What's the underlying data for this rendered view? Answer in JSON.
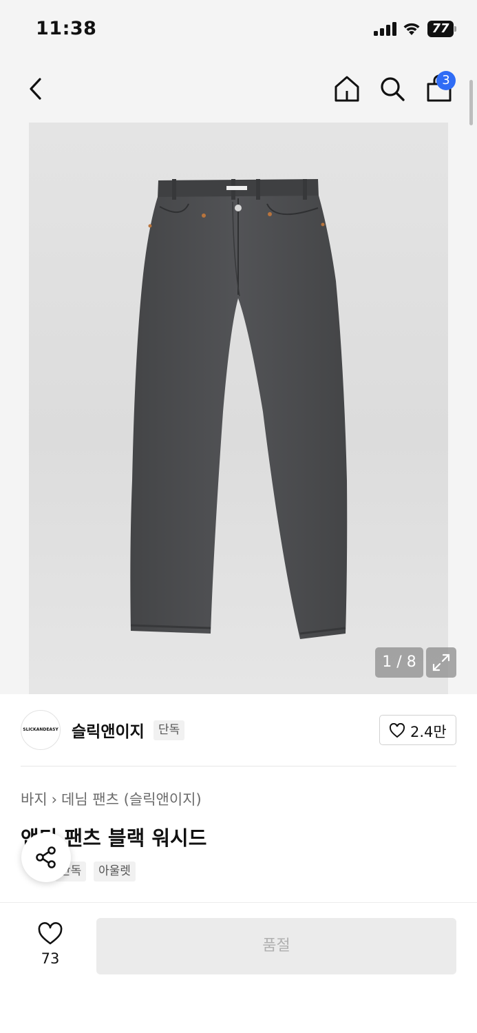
{
  "status_bar": {
    "time": "11:38",
    "battery": "77"
  },
  "header": {
    "back_icon": "chevron-left-icon",
    "home_icon": "home-icon",
    "search_icon": "search-icon",
    "bag_icon": "shopping-bag-icon",
    "bag_count": "3"
  },
  "gallery": {
    "counter": "1 / 8",
    "expand_icon": "expand-icon"
  },
  "brand": {
    "logo_text": "SLICKANDEASY",
    "name": "슬릭앤이지",
    "badge": "단독",
    "likes": "2.4만"
  },
  "product": {
    "breadcrumb": [
      "바지",
      "데님 팬츠 (슬릭앤이지)"
    ],
    "title": "앤디 팬츠 블랙 워시드",
    "tags": [
      "단독",
      "아울렛"
    ]
  },
  "bottom_bar": {
    "wish_count": "73",
    "action_label": "품절"
  },
  "colors": {
    "accent": "#2f6cf5",
    "denim": "#4a4b4d"
  }
}
